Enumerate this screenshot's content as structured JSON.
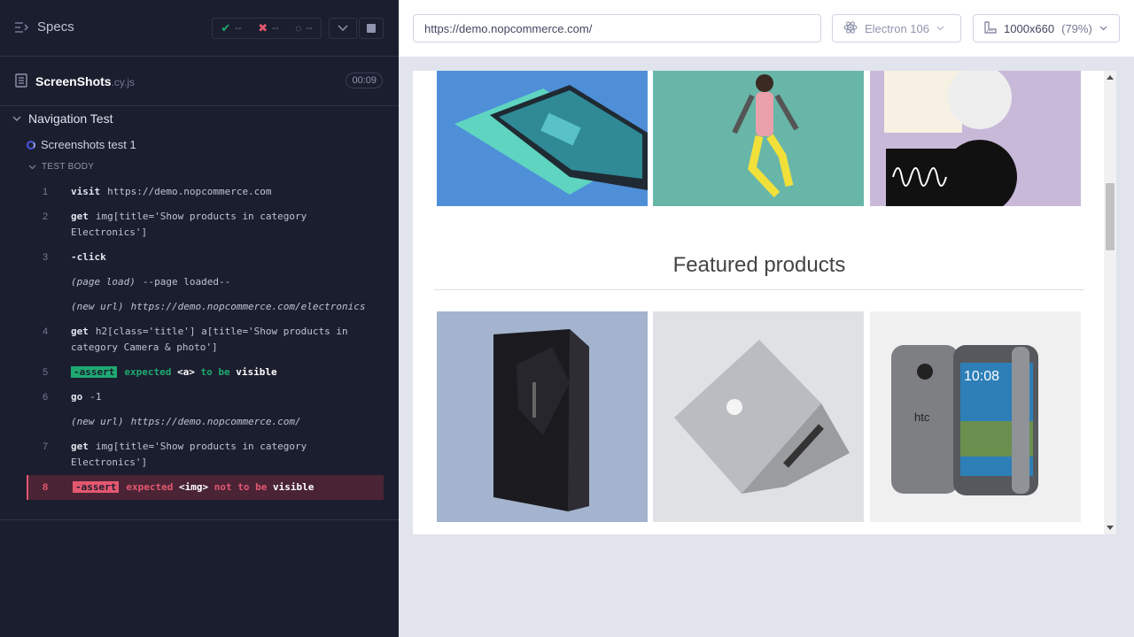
{
  "reporter": {
    "specs_label": "Specs",
    "stats": {
      "passed": "--",
      "failed": "--",
      "pending": "--"
    },
    "spec": {
      "name": "ScreenShots",
      "ext": ".cy.js",
      "timer": "00:09"
    },
    "suite_title": "Navigation Test",
    "test_title": "Screenshots test 1",
    "test_body_label": "TEST BODY",
    "commands": [
      {
        "num": "1",
        "name": "visit",
        "msg": "https://demo.nopcommerce.com"
      },
      {
        "num": "2",
        "name": "get",
        "msg": "img[title='Show products in category Electronics']"
      },
      {
        "num": "3",
        "name": "-click",
        "msg": ""
      },
      {
        "num": "",
        "name": "(page load)",
        "msg": "--page loaded--"
      },
      {
        "num": "",
        "name": "(new url)",
        "msg": "https://demo.nopcommerce.com/electronics"
      },
      {
        "num": "4",
        "name": "get",
        "msg": "h2[class='title'] a[title='Show products in category Camera & photo']"
      },
      {
        "num": "5",
        "name": "-assert",
        "msg_a": "expected",
        "msg_b": "<a>",
        "msg_c": "to be",
        "msg_d": "visible"
      },
      {
        "num": "6",
        "name": "go",
        "msg": "-1"
      },
      {
        "num": "",
        "name": "(new url)",
        "msg": "https://demo.nopcommerce.com/"
      },
      {
        "num": "7",
        "name": "get",
        "msg": "img[title='Show products in category Electronics']"
      },
      {
        "num": "8",
        "name": "-assert",
        "msg_a": "expected",
        "msg_b": "<img>",
        "msg_c": "not to be",
        "msg_d": "visible"
      }
    ]
  },
  "aut": {
    "url": "https://demo.nopcommerce.com/",
    "browser": "Electron 106",
    "viewport": "1000x660",
    "zoom": "(79%)",
    "featured_title": "Featured products",
    "product_brand_text": "htc",
    "phone_time": "10:08"
  },
  "colors": {
    "pass": "#1fa971",
    "fail": "#e45770",
    "accent": "#4956e3",
    "reporter_bg": "#1b1e2e"
  }
}
